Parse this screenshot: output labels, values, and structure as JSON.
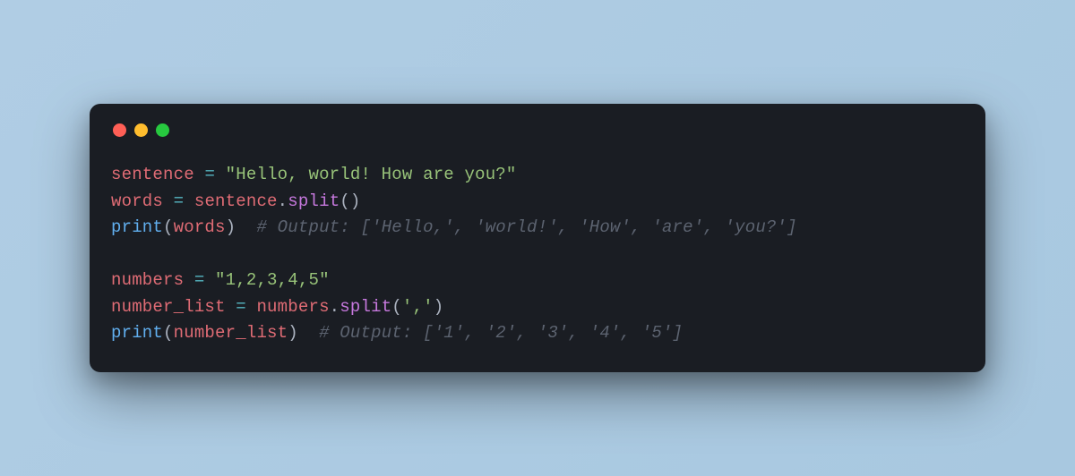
{
  "colors": {
    "background_gradient_start": "#b0cde4",
    "background_gradient_end": "#a8c8e0",
    "window_bg": "#1a1d23",
    "dot_red": "#ff5f56",
    "dot_yellow": "#ffbd2e",
    "dot_green": "#27c93f",
    "token_variable": "#e06c75",
    "token_operator": "#56b6c2",
    "token_string": "#98c379",
    "token_function": "#61afef",
    "token_method": "#c678dd",
    "token_punct": "#abb2bf",
    "token_comment": "#5c6370"
  },
  "code": {
    "line1": {
      "var": "sentence",
      "sp1": " ",
      "op": "=",
      "sp2": " ",
      "str": "\"Hello, world! How are you?\""
    },
    "line2": {
      "var1": "words",
      "sp1": " ",
      "op": "=",
      "sp2": " ",
      "var2": "sentence",
      "dot": ".",
      "method": "split",
      "paren": "()"
    },
    "line3": {
      "func": "print",
      "lpar": "(",
      "var": "words",
      "rpar": ")",
      "sp": "  ",
      "comment": "# Output: ['Hello,', 'world!', 'How', 'are', 'you?']"
    },
    "blank": "",
    "line5": {
      "var": "numbers",
      "sp1": " ",
      "op": "=",
      "sp2": " ",
      "str": "\"1,2,3,4,5\""
    },
    "line6": {
      "var1": "number_list",
      "sp1": " ",
      "op": "=",
      "sp2": " ",
      "var2": "numbers",
      "dot": ".",
      "method": "split",
      "lpar": "(",
      "arg": "','",
      "rpar": ")"
    },
    "line7": {
      "func": "print",
      "lpar": "(",
      "var": "number_list",
      "rpar": ")",
      "sp": "  ",
      "comment": "# Output: ['1', '2', '3', '4', '5']"
    }
  }
}
